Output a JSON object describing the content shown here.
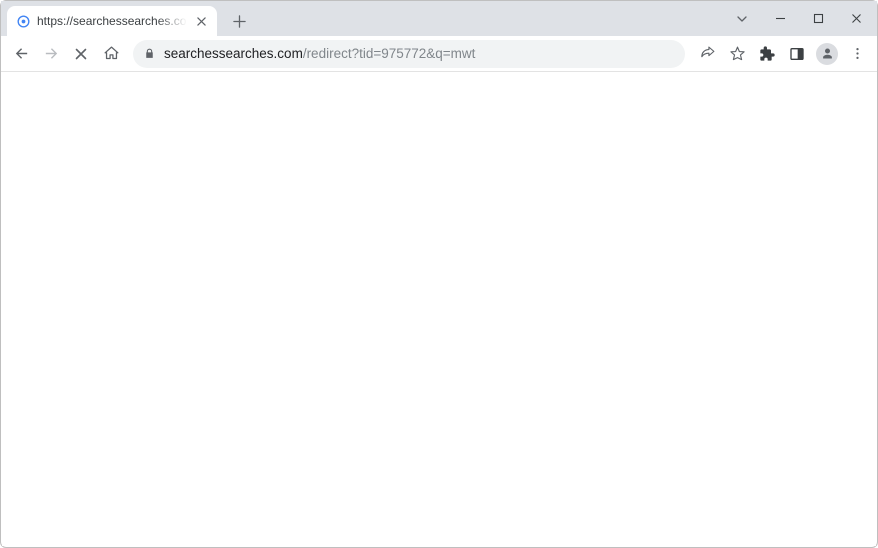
{
  "tab": {
    "title": "https://searchessearches.com/re"
  },
  "address": {
    "domain": "searchessearches.com",
    "path": "/redirect?tid=975772&q=mwt"
  }
}
